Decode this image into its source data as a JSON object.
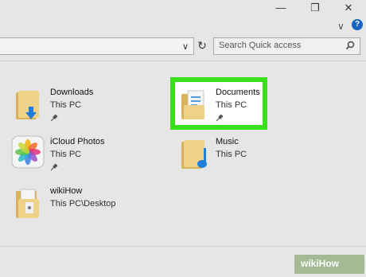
{
  "window": {
    "minimize_glyph": "—",
    "restore_glyph": "❐",
    "close_glyph": "✕"
  },
  "ribbon": {
    "collapse_glyph": "∨",
    "help_label": "?"
  },
  "address": {
    "dropdown_glyph": "∨",
    "refresh_glyph": "↻"
  },
  "search": {
    "placeholder": "Search Quick access"
  },
  "items": [
    {
      "name": "Downloads",
      "location": "This PC",
      "icon": "downloads-folder-icon",
      "pinned": true
    },
    {
      "name": "Documents",
      "location": "This PC",
      "icon": "documents-folder-icon",
      "pinned": true,
      "selected": true
    },
    {
      "name": "iCloud Photos",
      "location": "This PC",
      "icon": "icloud-photos-icon",
      "pinned": true
    },
    {
      "name": "Music",
      "location": "This PC",
      "icon": "music-folder-icon",
      "pinned": false
    },
    {
      "name": "wikiHow",
      "location": "This PC\\Desktop",
      "icon": "wikihow-folder-icon",
      "pinned": false
    }
  ],
  "colors": {
    "highlight": "#3ae01a",
    "folder": "#e8c46a",
    "accent": "#1565c0"
  },
  "watermark": "wikiHow"
}
